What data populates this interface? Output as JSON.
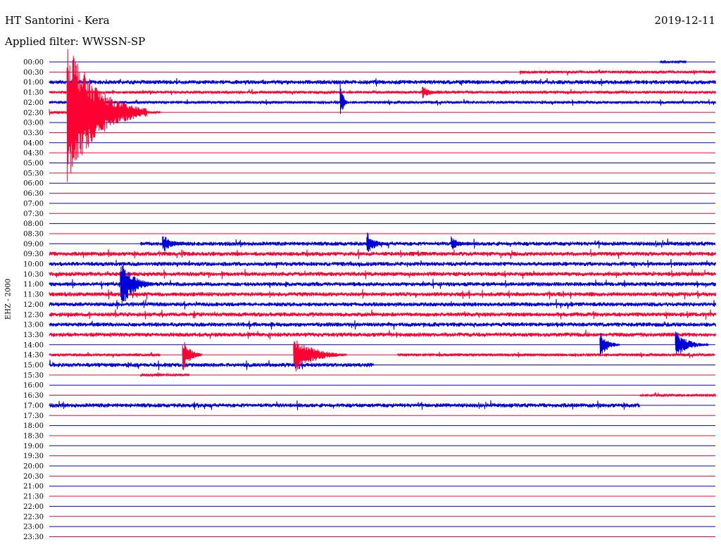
{
  "header": {
    "title": "HT Santorini - Kera",
    "date": "2019-12-11",
    "filter_label": "Applied filter: WWSSN-SP"
  },
  "chart_data": {
    "type": "line",
    "title": "HT Santorini - Kera",
    "ylabel": "EHZ - 2000",
    "row_labels": [
      "00:00",
      "00:30",
      "01:00",
      "01:30",
      "02:00",
      "02:30",
      "03:00",
      "03:30",
      "04:00",
      "04:30",
      "05:00",
      "05:30",
      "06:00",
      "06:30",
      "07:00",
      "07:30",
      "08:00",
      "08:30",
      "09:00",
      "09:30",
      "10:00",
      "10:30",
      "11:00",
      "11:30",
      "12:00",
      "12:30",
      "13:00",
      "13:30",
      "14:00",
      "14:30",
      "15:00",
      "15:30",
      "16:00",
      "16:30",
      "17:00",
      "17:30",
      "18:00",
      "18:30",
      "19:00",
      "19:30",
      "20:00",
      "20:30",
      "21:00",
      "21:30",
      "22:00",
      "22:30",
      "23:00",
      "23:30"
    ],
    "row_minutes": 30,
    "colors": {
      "even_rows": "#0000dd",
      "odd_rows": "#ff0033"
    },
    "segments": [
      {
        "row": "00:00",
        "start_min": 27.5,
        "end_min": 28.7,
        "amp": 2,
        "color": "blue"
      },
      {
        "row": "00:30",
        "start_min": 21.2,
        "end_min": 30,
        "amp": 2,
        "color": "red"
      },
      {
        "row": "01:00",
        "start_min": 0,
        "end_min": 30,
        "amp": 3,
        "color": "blue"
      },
      {
        "row": "01:30",
        "start_min": 0,
        "end_min": 30,
        "amp": 2,
        "color": "red"
      },
      {
        "row": "02:00",
        "start_min": 0,
        "end_min": 30,
        "amp": 2,
        "color": "blue"
      },
      {
        "row": "02:30",
        "start_min": 0,
        "end_min": 5.0,
        "amp": 2,
        "color": "red"
      },
      {
        "row": "09:00",
        "start_min": 4.1,
        "end_min": 30,
        "amp": 3,
        "color": "blue"
      },
      {
        "row": "09:30",
        "start_min": 0,
        "end_min": 30,
        "amp": 3,
        "color": "red"
      },
      {
        "row": "10:00",
        "start_min": 0,
        "end_min": 30,
        "amp": 3,
        "color": "blue"
      },
      {
        "row": "10:30",
        "start_min": 0,
        "end_min": 30,
        "amp": 3,
        "color": "red"
      },
      {
        "row": "11:00",
        "start_min": 0,
        "end_min": 30,
        "amp": 3,
        "color": "blue"
      },
      {
        "row": "11:30",
        "start_min": 0,
        "end_min": 30,
        "amp": 3,
        "color": "red"
      },
      {
        "row": "12:00",
        "start_min": 0,
        "end_min": 30,
        "amp": 3,
        "color": "blue"
      },
      {
        "row": "12:30",
        "start_min": 0,
        "end_min": 30,
        "amp": 3,
        "color": "red"
      },
      {
        "row": "13:00",
        "start_min": 0,
        "end_min": 30,
        "amp": 3,
        "color": "blue"
      },
      {
        "row": "13:30",
        "start_min": 0,
        "end_min": 30,
        "amp": 3,
        "color": "red"
      },
      {
        "row": "14:30",
        "start_min": 0,
        "end_min": 5.0,
        "amp": 2,
        "color": "red"
      },
      {
        "row": "14:30",
        "start_min": 15.7,
        "end_min": 30,
        "amp": 2,
        "color": "red"
      },
      {
        "row": "15:00",
        "start_min": 0,
        "end_min": 14.6,
        "amp": 3,
        "color": "blue"
      },
      {
        "row": "15:30",
        "start_min": 4.1,
        "end_min": 6.3,
        "amp": 2,
        "color": "red"
      },
      {
        "row": "16:30",
        "start_min": 26.6,
        "end_min": 30,
        "amp": 2,
        "color": "red"
      },
      {
        "row": "17:00",
        "start_min": 0,
        "end_min": 26.6,
        "amp": 3,
        "color": "blue"
      }
    ],
    "events": [
      {
        "row": "02:30",
        "min": 0.8,
        "amp": 110,
        "decay_min": 1.2,
        "color": "red"
      },
      {
        "row": "11:00",
        "min": 3.2,
        "amp": 38,
        "decay_min": 0.5,
        "color": "blue"
      },
      {
        "row": "01:30",
        "min": 16.8,
        "amp": 10,
        "decay_min": 0.3,
        "color": "red"
      },
      {
        "row": "02:00",
        "min": 13.1,
        "amp": 30,
        "decay_min": 0.1,
        "color": "blue"
      },
      {
        "row": "14:30",
        "min": 11.0,
        "amp": 28,
        "decay_min": 0.8,
        "color": "red"
      },
      {
        "row": "14:30",
        "min": 6.0,
        "amp": 25,
        "decay_min": 0.3,
        "color": "red"
      },
      {
        "row": "14:00",
        "min": 24.8,
        "amp": 20,
        "decay_min": 0.3,
        "color": "blue"
      },
      {
        "row": "14:00",
        "min": 28.2,
        "amp": 20,
        "decay_min": 0.5,
        "color": "blue"
      },
      {
        "row": "09:00",
        "min": 14.3,
        "amp": 18,
        "decay_min": 0.3,
        "color": "blue"
      },
      {
        "row": "09:00",
        "min": 5.1,
        "amp": 14,
        "decay_min": 0.4,
        "color": "blue"
      },
      {
        "row": "09:00",
        "min": 18.1,
        "amp": 12,
        "decay_min": 0.3,
        "color": "blue"
      }
    ]
  }
}
